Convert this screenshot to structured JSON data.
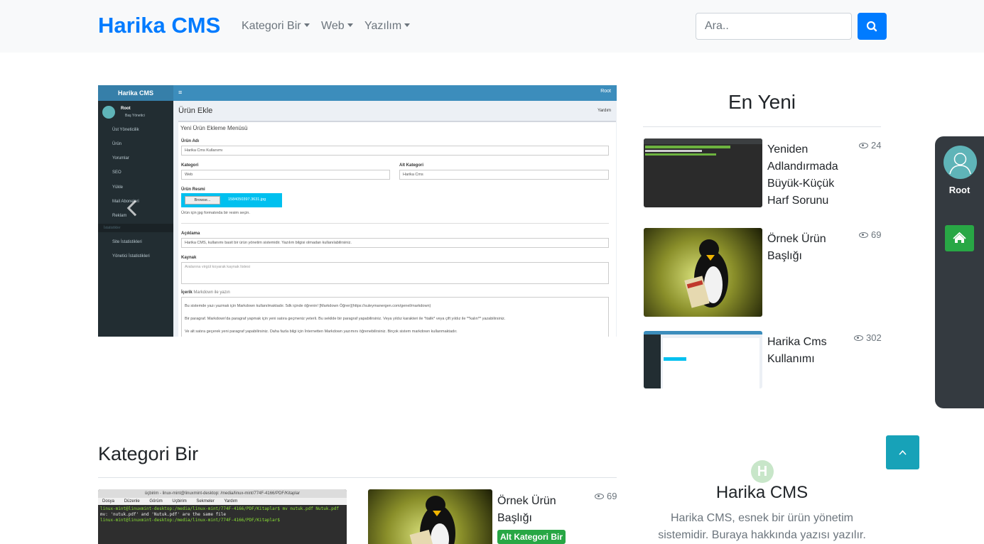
{
  "navbar": {
    "brand": "Harika CMS",
    "menu": [
      {
        "label": "Kategori Bir"
      },
      {
        "label": "Web"
      },
      {
        "label": "Yazılım"
      }
    ],
    "search_placeholder": "Ara..",
    "search_icon": "search-icon"
  },
  "slider": {
    "admin_brand": "Harika CMS",
    "admin_user": "Root",
    "admin_user_role": "Baş Yönetici",
    "sidebar_items": [
      "Üst Yöneticilik",
      "Ürün",
      "Yorumlar",
      "SEO",
      "Yükle",
      "Mail Aboneleri",
      "Reklam"
    ],
    "sidebar_section": "İstatistikler",
    "sidebar_stats": [
      "Site İstatistikleri",
      "Yönetici İstatistikleri"
    ],
    "page_title": "Ürün Ekle",
    "page_link": "Yardım",
    "box_title": "Yeni Ürün Ekleme Menüsü",
    "fields": {
      "name_label": "Ürün Adı",
      "name_value": "Harika Cms Kullanımı",
      "category_label": "Kategori",
      "category_value": "Web",
      "subcategory_label": "Alt Kategori",
      "subcategory_value": "Harika Cms",
      "image_label": "Ürün Resmi",
      "browse": "Browse...",
      "file_name": "1584050397.3631.jpg",
      "image_hint": "Ürün için jpg formatında bir resim seçin.",
      "desc_label": "Açıklama",
      "desc_value": "Harika CMS, kullanımı basit bir ürün yönetim sistemidir. Yazılım bilgisi olmadan kullanılabilirsiniz.",
      "source_label": "Kaynak",
      "source_placeholder": "Aralarına virgül koyarak kaynak listesi",
      "content_label": "İçerik",
      "content_hint": "Markdown ile yazın",
      "content_line1": "Bu sistemde yazı yazmak için Markdown kullanılmaktadır. 5dk içinde öğrenin! [Markdown Öğren](https://suleymanergen.com/genel/markdown)",
      "content_line2": "Bir paragraf. Markdown'da paragraf yapmak için yeni satıra geçmeniz yeterli. Bu sekilde bir paragraf yapabilirsiniz. Veya yıldız karakteri ile *italik* veya çift yıldız ile **kalın** yazabilirsiniz.",
      "content_line3": "Ve alt satıra geçerek yeni paragraf yapabilirsiniz. Daha fazla bilgi için İnternetten Markdown yazımını öğrenebilirsiniz. Birçok sistem markdown kullanmaktadır."
    }
  },
  "latest": {
    "title": "En Yeni",
    "posts": [
      {
        "title": "Yeniden Adlandırmada Büyük-Küçük Harf Sorunu",
        "views": "24"
      },
      {
        "title": "Örnek Ürün Başlığı",
        "views": "69"
      },
      {
        "title": "Harika Cms Kullanımı",
        "views": "302"
      }
    ]
  },
  "user_panel": {
    "name": "Root",
    "home_icon": "home-icon"
  },
  "category_section": {
    "title": "Kategori Bir",
    "terminal_title": "üçbirim - linux-mint@linuxmint-desktop: /media/linux-mint/774F-4166/PDF/Kitaplar",
    "terminal_menu": [
      "Dosya",
      "Düzenle",
      "Görüm",
      "Uçbirim",
      "Sekmeler",
      "Yardım"
    ],
    "terminal_line1": "linux-mint@linuxmint-desktop:/media/linux-mint/774F-4166/PDF/Kitaplar$ mv nutuk.pdf Nutuk.pdf",
    "terminal_line2": "mv: 'nutuk.pdf' and 'Nutuk.pdf' are the same file",
    "terminal_line3": "linux-mint@linuxmint-desktop:/media/linux-mint/774F-4166/PDF/Kitaplar$",
    "post": {
      "title": "Örnek Ürün Başlığı",
      "views": "69",
      "badge": "Alt Kategori Bir"
    }
  },
  "footer": {
    "logo_letter": "H",
    "title": "Harika CMS",
    "text": "Harika CMS, esnek bir ürün yönetim sistemidir. Buraya hakkında yazısı yazılır."
  }
}
